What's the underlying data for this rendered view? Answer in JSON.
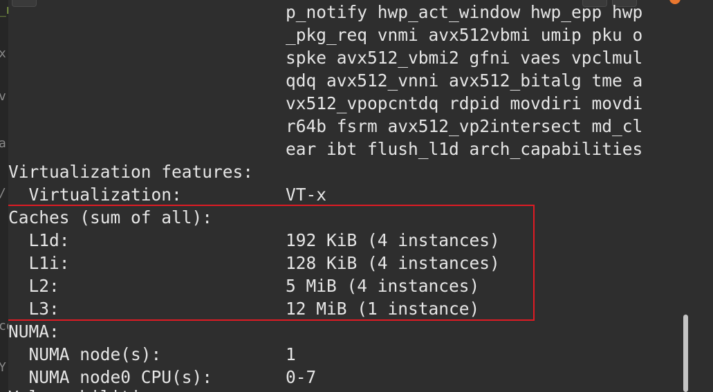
{
  "background_fragments": [
    {
      "text": "_n",
      "color": "#8fb24a"
    },
    {
      "text": "x",
      "color": "#8a8a8a"
    },
    {
      "text": "v",
      "color": "#8a8a8a"
    },
    {
      "text": "a",
      "color": "#8a8a8a"
    },
    {
      "text": "/",
      "color": "#8a8a8a"
    },
    {
      "text": "co",
      "color": "#8a8a8a"
    },
    {
      "text": "Y",
      "color": "#8a8a8a"
    }
  ],
  "flags_lines": [
    "p_notify hwp_act_window hwp_epp hwp",
    "_pkg_req vnmi avx512vbmi umip pku o",
    "spke avx512_vbmi2 gfni vaes vpclmul",
    "qdq avx512_vnni avx512_bitalg tme a",
    "vx512_vpopcntdq rdpid movdiri movdi",
    "r64b fsrm avx512_vp2intersect md_cl",
    "ear ibt flush_l1d arch_capabilities"
  ],
  "virtualization": {
    "heading": "Virtualization features:",
    "label": "  Virtualization:",
    "value": "VT-x"
  },
  "caches": {
    "heading": "Caches (sum of all):",
    "rows": [
      {
        "label": "  L1d:",
        "value": "192 KiB (4 instances)"
      },
      {
        "label": "  L1i:",
        "value": "128 KiB (4 instances)"
      },
      {
        "label": "  L2:",
        "value": "5 MiB (4 instances)"
      },
      {
        "label": "  L3:",
        "value": "12 MiB (1 instance)"
      }
    ]
  },
  "numa": {
    "heading": "NUMA:",
    "rows": [
      {
        "label": "  NUMA node(s):",
        "value": "1"
      },
      {
        "label": "  NUMA node0 CPU(s):",
        "value": "0-7"
      }
    ]
  },
  "cut_off_line": "Vulnerabilities:",
  "colors": {
    "highlight_border": "#e01b24",
    "text": "#e6e6e6",
    "terminal_bg": "#2e2e2e",
    "accent_dot": "#e9772f"
  }
}
